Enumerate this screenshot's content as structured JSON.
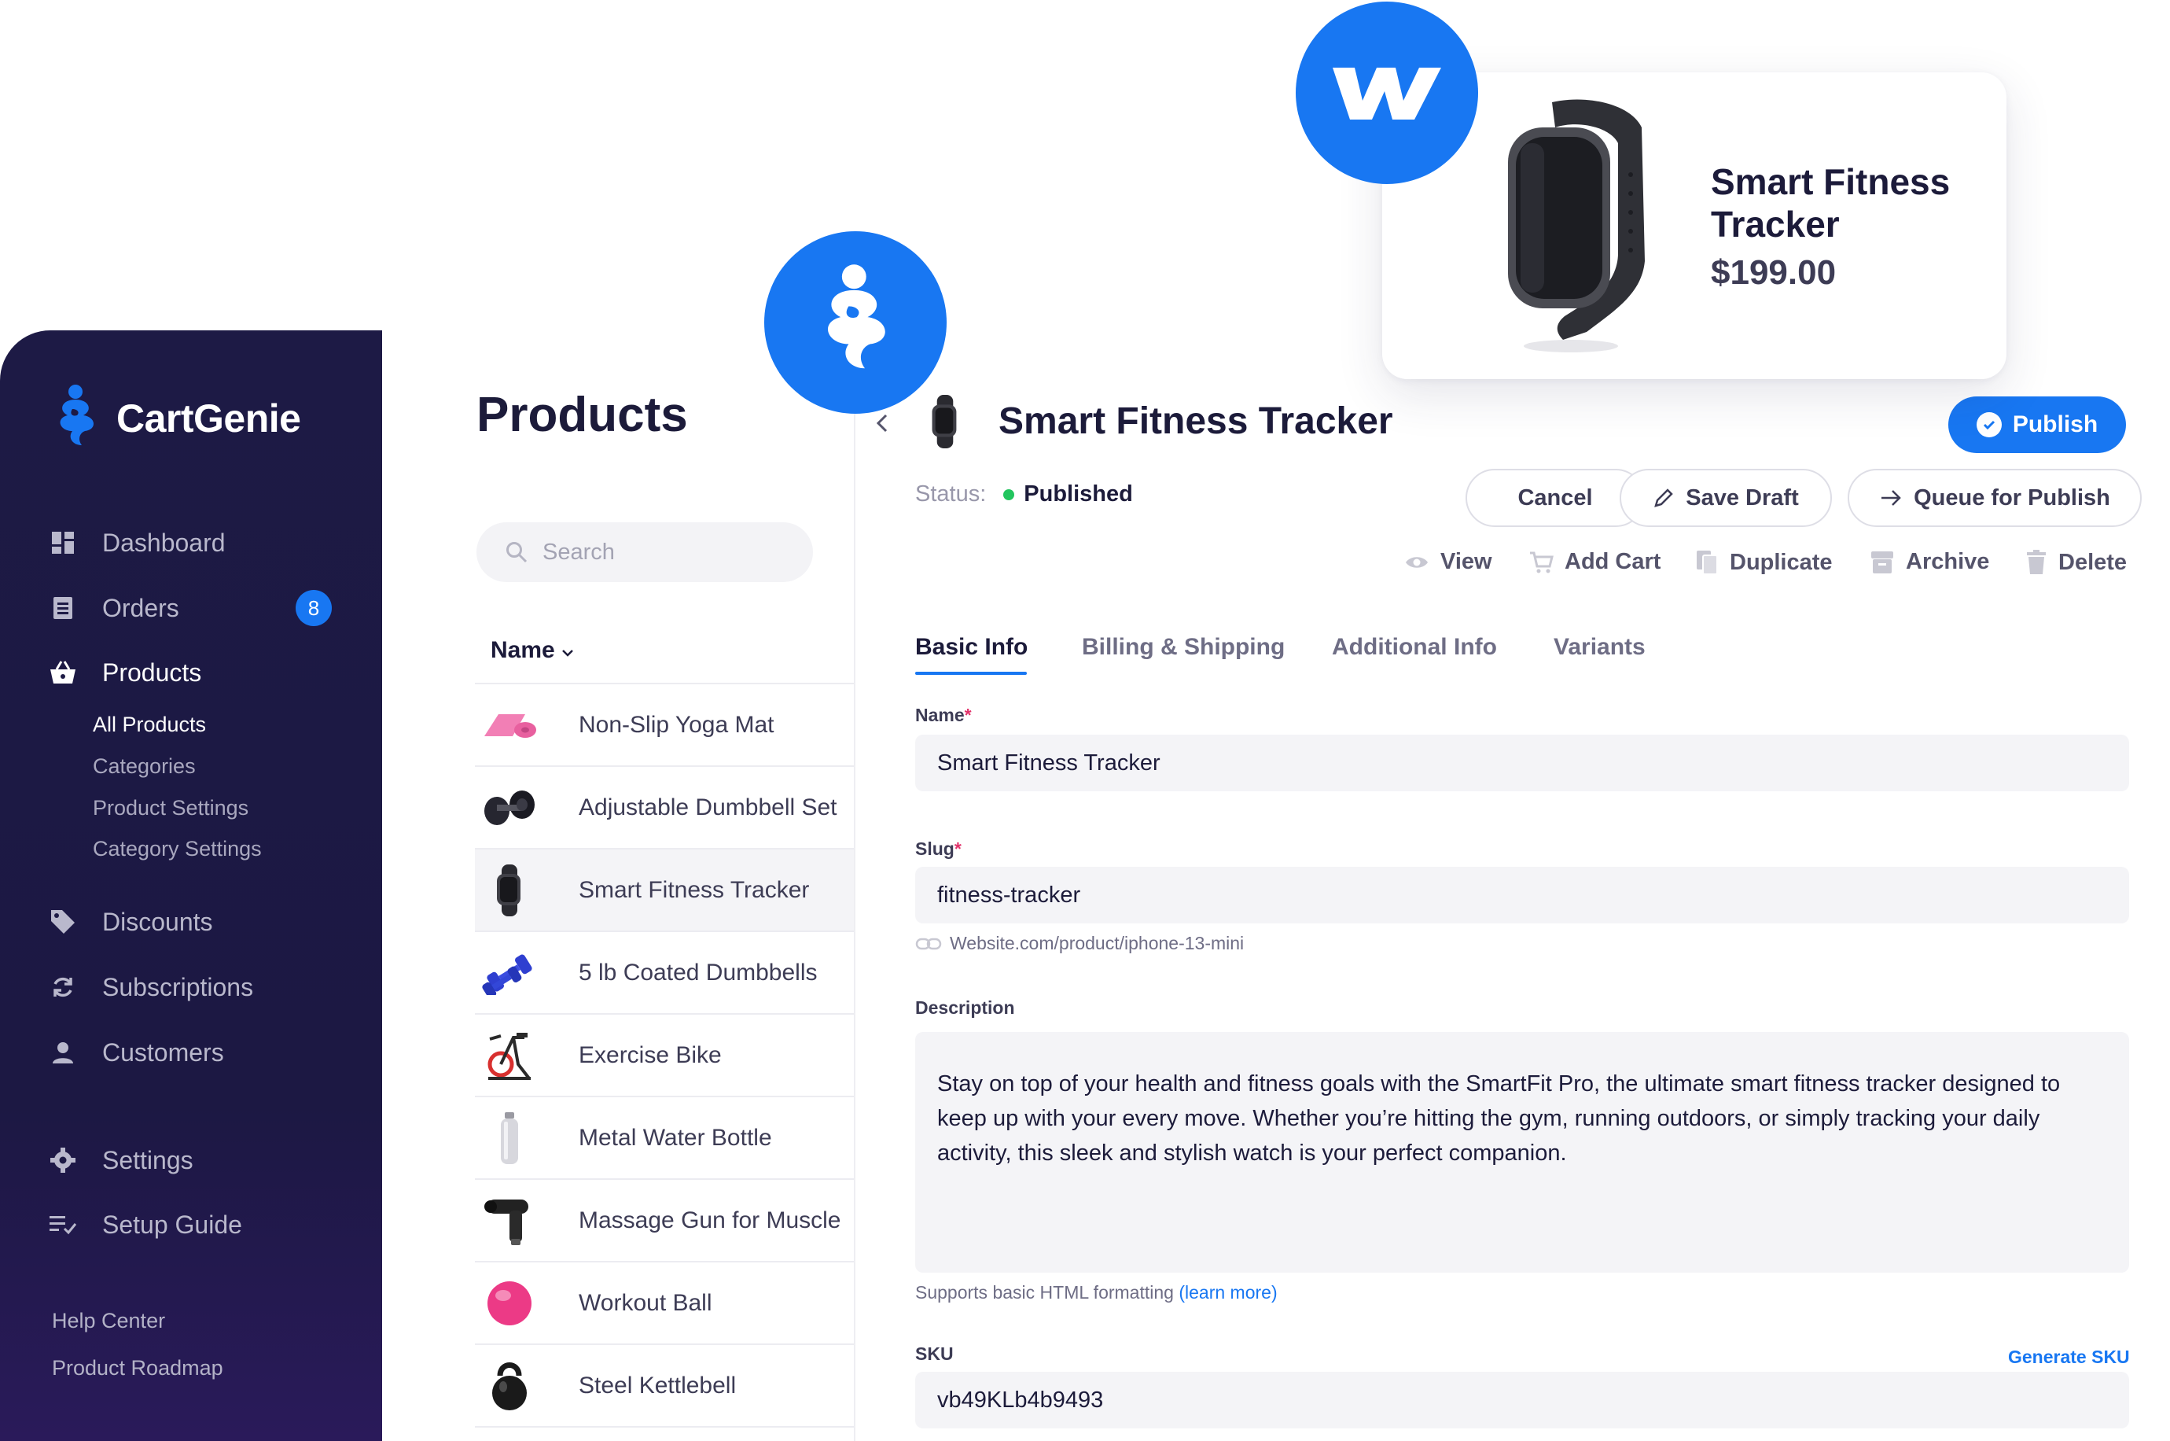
{
  "brand": {
    "name": "CartGenie",
    "accent": "#1877f2",
    "sidebar_bg": "#1d1a45"
  },
  "sidebar": {
    "items": [
      {
        "label": "Dashboard",
        "icon": "dashboard-icon"
      },
      {
        "label": "Orders",
        "icon": "orders-icon",
        "badge": "8"
      },
      {
        "label": "Products",
        "icon": "basket-icon",
        "active": true
      },
      {
        "label": "Discounts",
        "icon": "tag-icon"
      },
      {
        "label": "Subscriptions",
        "icon": "refresh-icon"
      },
      {
        "label": "Customers",
        "icon": "person-icon"
      },
      {
        "label": "Settings",
        "icon": "gear-icon"
      },
      {
        "label": "Setup Guide",
        "icon": "checklist-icon"
      }
    ],
    "subitems": [
      {
        "label": "All Products",
        "active": true
      },
      {
        "label": "Categories"
      },
      {
        "label": "Product Settings"
      },
      {
        "label": "Category Settings"
      }
    ],
    "footer": [
      "Help Center",
      "Product Roadmap"
    ]
  },
  "products": {
    "title": "Products",
    "search_placeholder": "Search",
    "sort_label": "Name",
    "rows": [
      {
        "name": "Non-Slip Yoga Mat",
        "icon": "yoga-mat-thumb"
      },
      {
        "name": "Adjustable Dumbbell Set",
        "icon": "dumbbell-set-thumb"
      },
      {
        "name": "Smart Fitness Tracker",
        "icon": "fitness-tracker-thumb",
        "selected": true
      },
      {
        "name": "5 lb Coated Dumbbells",
        "icon": "dumbbells-thumb"
      },
      {
        "name": "Exercise Bike",
        "icon": "exercise-bike-thumb"
      },
      {
        "name": "Metal Water Bottle",
        "icon": "water-bottle-thumb"
      },
      {
        "name": "Massage Gun for Muscle",
        "icon": "massage-gun-thumb"
      },
      {
        "name": "Workout Ball",
        "icon": "workout-ball-thumb"
      },
      {
        "name": "Steel Kettlebell",
        "icon": "kettlebell-thumb"
      }
    ]
  },
  "editor": {
    "title": "Smart Fitness Tracker",
    "publish_label": "Publish",
    "status_label": "Status:",
    "status_value": "Published",
    "buttons": {
      "cancel": "Cancel",
      "save_draft": "Save Draft",
      "queue": "Queue for Publish"
    },
    "actions": {
      "view": "View",
      "add_cart": "Add Cart",
      "duplicate": "Duplicate",
      "archive": "Archive",
      "delete": "Delete"
    },
    "tabs": [
      "Basic Info",
      "Billing & Shipping",
      "Additional Info",
      "Variants"
    ],
    "fields": {
      "name_label": "Name",
      "name_value": "Smart Fitness Tracker",
      "slug_label": "Slug",
      "slug_value": "fitness-tracker",
      "slug_url": "Website.com/product/iphone-13-mini",
      "description_label": "Description",
      "description_value": "Stay on top of your health and fitness goals with the SmartFit Pro, the ultimate smart fitness tracker designed to keep up with your every move. Whether you’re hitting the gym, running outdoors, or simply tracking your daily activity, this sleek and stylish watch is your perfect companion.",
      "hint_text": "Supports basic HTML formatting",
      "hint_link": "(learn more)",
      "sku_label": "SKU",
      "sku_value": "vb49KLb4b9493",
      "generate_sku": "Generate SKU",
      "required_mark": "*"
    }
  },
  "preview_card": {
    "title": "Smart Fitness Tracker",
    "price": "$199.00"
  }
}
